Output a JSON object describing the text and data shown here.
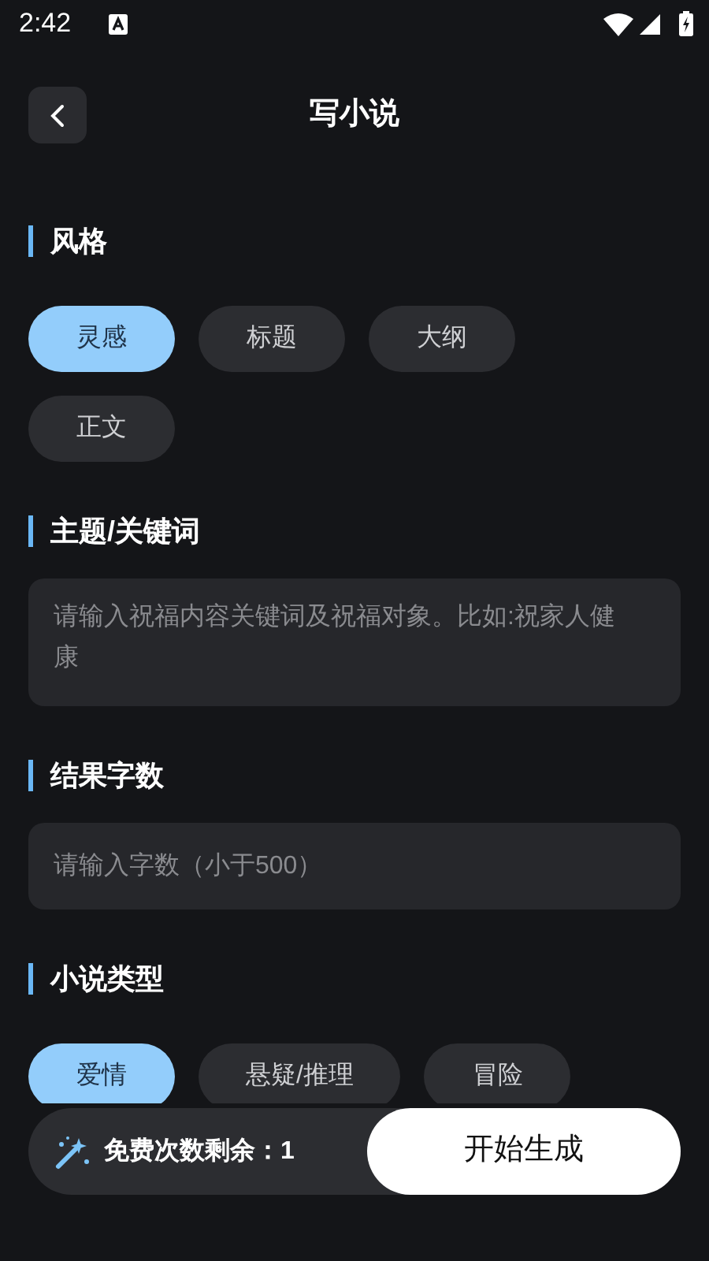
{
  "status_bar": {
    "time": "2:42"
  },
  "header": {
    "title": "写小说"
  },
  "sections": [
    {
      "title": "风格",
      "kind": "chips",
      "options": [
        {
          "label": "灵感",
          "selected": true
        },
        {
          "label": "标题",
          "selected": false
        },
        {
          "label": "大纲",
          "selected": false
        },
        {
          "label": "正文",
          "selected": false
        }
      ]
    },
    {
      "title": "主题/关键词",
      "kind": "textarea",
      "placeholder": "请输入祝福内容关键词及祝福对象。比如:祝家人健康"
    },
    {
      "title": "结果字数",
      "kind": "input",
      "placeholder": "请输入字数（小于500）"
    },
    {
      "title": "小说类型",
      "kind": "chips",
      "options": [
        {
          "label": "爱情",
          "selected": true
        },
        {
          "label": "悬疑/推理",
          "selected": false
        },
        {
          "label": "冒险",
          "selected": false
        }
      ]
    }
  ],
  "footer": {
    "free_uses": "免费次数剩余：1",
    "button": "开始生成"
  }
}
